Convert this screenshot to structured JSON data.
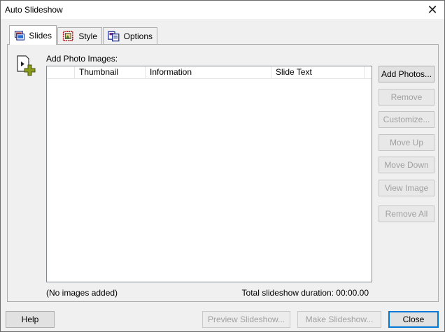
{
  "window": {
    "title": "Auto Slideshow",
    "close_glyph": "✕"
  },
  "tabs": [
    {
      "label": "Slides",
      "icon": "slides-icon",
      "active": true
    },
    {
      "label": "Style",
      "icon": "style-icon",
      "active": false
    },
    {
      "label": "Options",
      "icon": "options-icon",
      "active": false
    }
  ],
  "panel": {
    "add_label": "Add Photo Images:",
    "columns": [
      "",
      "Thumbnail",
      "Information",
      "Slide Text"
    ],
    "status_left": "(No images added)",
    "status_right": "Total slideshow duration: 00:00.00"
  },
  "side_buttons": [
    {
      "label": "Add Photos...",
      "enabled": true
    },
    {
      "label": "Remove",
      "enabled": false
    },
    {
      "label": "Customize...",
      "enabled": false
    },
    {
      "label": "Move Up",
      "enabled": false
    },
    {
      "label": "Move Down",
      "enabled": false
    },
    {
      "label": "View Image",
      "enabled": false
    },
    {
      "label": "Remove All",
      "enabled": false
    }
  ],
  "bottom_buttons": {
    "help": "Help",
    "preview": "Preview Slideshow...",
    "make": "Make Slideshow...",
    "close": "Close"
  },
  "colors": {
    "accent": "#0078d7",
    "disabled_text": "#a0a0a0",
    "icon_green": "#8a9a1a"
  }
}
